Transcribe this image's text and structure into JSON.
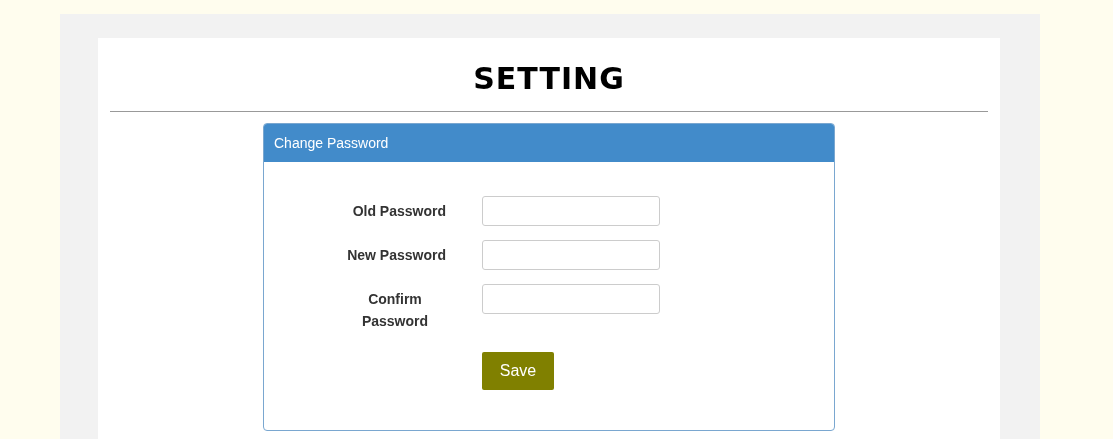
{
  "title": "SETTING",
  "panel": {
    "heading": "Change Password",
    "fields": [
      {
        "label": "Old Password"
      },
      {
        "label": "New Password"
      },
      {
        "label": "Confirm Password"
      }
    ],
    "button": "Save"
  }
}
